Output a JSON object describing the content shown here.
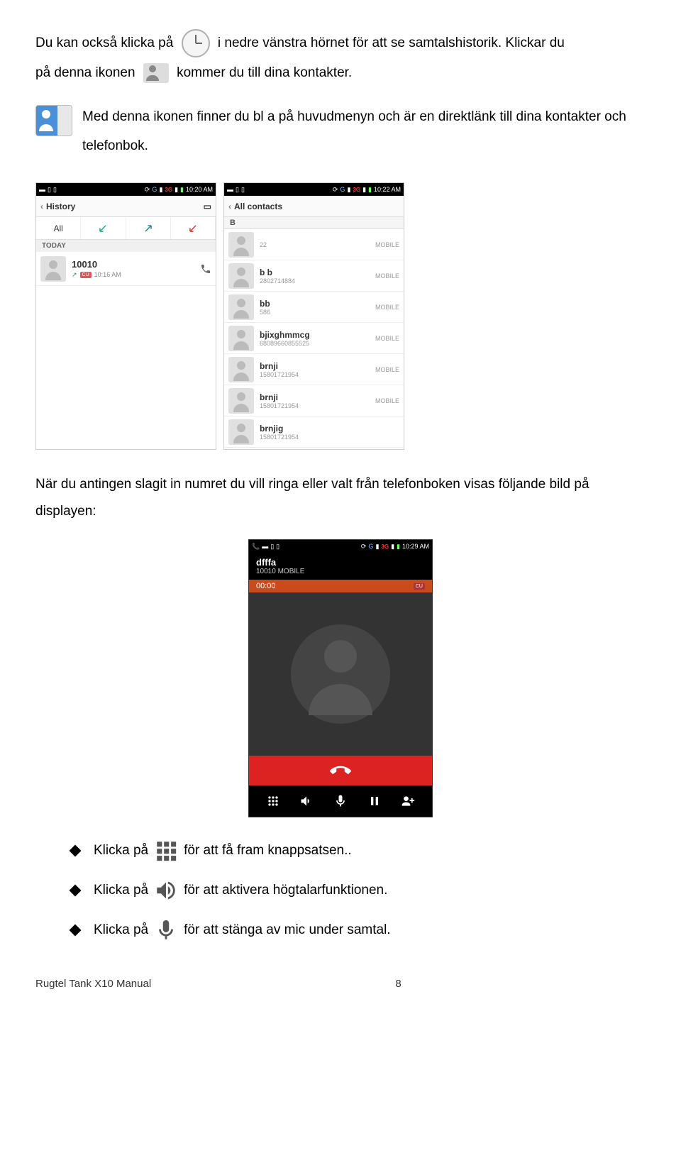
{
  "para1": {
    "t1": "Du kan också klicka på",
    "t2": "i nedre vänstra hörnet för att se samtalshistorik. Klickar du",
    "t3": "på denna ikonen",
    "t4": "kommer du till dina kontakter."
  },
  "para2": "Med denna ikonen finner du bl a på huvudmenyn och är en direktlänk till dina kontakter och telefonbok.",
  "screenshot1": {
    "time": "10:20 AM",
    "status_3g": "3G",
    "header": "History",
    "tabs": {
      "all": "All"
    },
    "section": "TODAY",
    "call": {
      "name": "10010",
      "badge": "CU",
      "time": "10:16 AM"
    }
  },
  "screenshot2": {
    "time": "10:22 AM",
    "status_3g": "3G",
    "header": "All contacts",
    "letter": "B",
    "contacts": [
      {
        "name": "",
        "num": "22",
        "type": "MOBILE"
      },
      {
        "name": "b b",
        "num": "2802714884",
        "type": "MOBILE"
      },
      {
        "name": "bb",
        "num": "586",
        "type": "MOBILE"
      },
      {
        "name": "bjixghmmcg",
        "num": "68089660855525",
        "type": "MOBILE"
      },
      {
        "name": "brnji",
        "num": "15801721954",
        "type": "MOBILE"
      },
      {
        "name": "brnji",
        "num": "15801721954",
        "type": "MOBILE"
      },
      {
        "name": "brnjig",
        "num": "15801721954",
        "type": ""
      }
    ]
  },
  "para3": "När du antingen slagit in numret du vill ringa eller valt från telefonboken visas följande bild på displayen:",
  "screenshot3": {
    "time": "10:29 AM",
    "status_3g": "3G",
    "name": "dfffa",
    "sub": "10010 MOBILE",
    "timer": "00:00",
    "badge": "CU"
  },
  "bullets": {
    "pre": "Klicka på",
    "b1_post": "för att få fram knappsatsen..",
    "b2_post": "för att aktivera högtalarfunktionen.",
    "b3_post": "för att stänga av mic under samtal."
  },
  "footer": {
    "title": "Rugtel Tank X10 Manual",
    "page": "8"
  }
}
